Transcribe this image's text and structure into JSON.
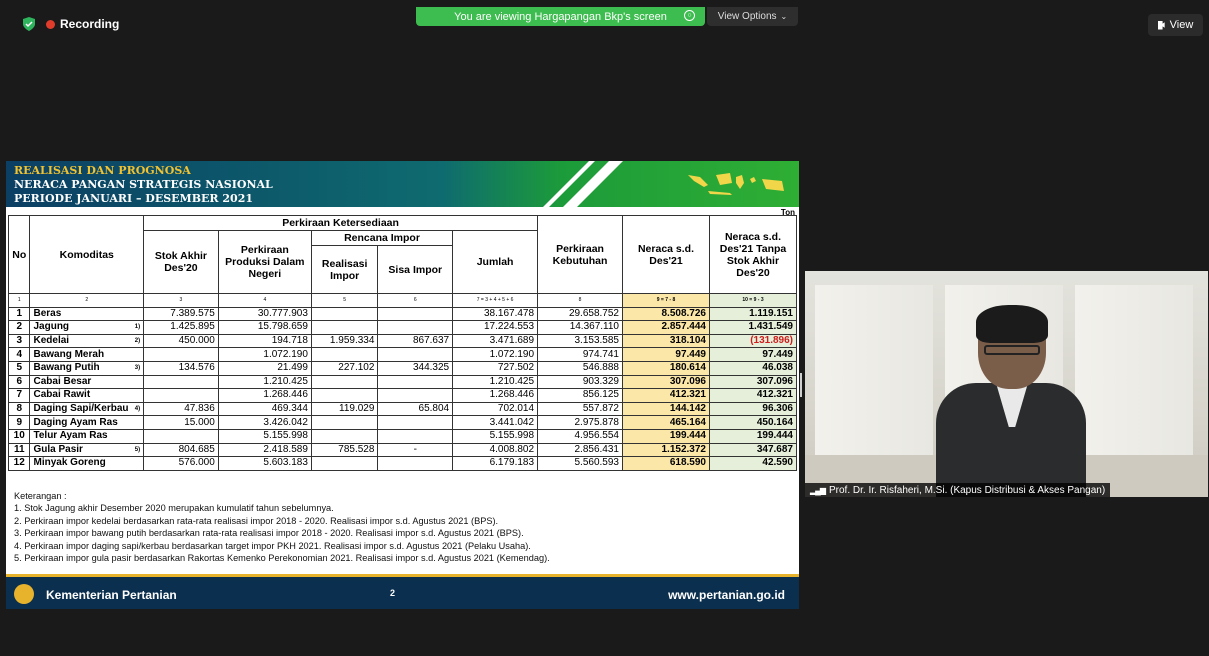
{
  "topbar": {
    "recording_label": "Recording",
    "share_banner": "You are viewing Hargapangan Bkp's screen",
    "view_options": "View Options",
    "view_button": "View"
  },
  "slide": {
    "title_line1": "REALISASI DAN PROGNOSA",
    "title_line2": "NERACA PANGAN STRATEGIS NASIONAL",
    "title_line3": "PERIODE JANUARI – DESEMBER 2021",
    "unit": "Ton",
    "headers": {
      "no": "No",
      "komoditas": "Komoditas",
      "perkiraan_ketersediaan": "Perkiraan Ketersediaan",
      "rencana_impor": "Rencana Impor",
      "stok_akhir": "Stok Akhir Des'20",
      "produksi": "Perkiraan Produksi Dalam Negeri",
      "realisasi_impor": "Realisasi Impor",
      "sisa_impor": "Sisa Impor",
      "jumlah": "Jumlah",
      "kebutuhan": "Perkiraan Kebutuhan",
      "neraca": "Neraca s.d. Des'21",
      "neraca_tanpa_stok": "Neraca s.d. Des'21 Tanpa Stok Akhir Des'20"
    },
    "index_row": [
      "1",
      "2",
      "3",
      "4",
      "5",
      "6",
      "7 = 3 + 4 + 5 + 6",
      "8",
      "9 = 7 - 8",
      "10 = 9 - 3"
    ],
    "rows": [
      {
        "no": "1",
        "name": "Beras",
        "note": "",
        "stok": "7.389.575",
        "produksi": "30.777.903",
        "realisasi": "",
        "sisa": "",
        "jumlah": "38.167.478",
        "kebutuhan": "29.658.752",
        "neraca": "8.508.726",
        "tanpa_stok": "1.119.151"
      },
      {
        "no": "2",
        "name": "Jagung",
        "note": "1)",
        "stok": "1.425.895",
        "produksi": "15.798.659",
        "realisasi": "",
        "sisa": "",
        "jumlah": "17.224.553",
        "kebutuhan": "14.367.110",
        "neraca": "2.857.444",
        "tanpa_stok": "1.431.549"
      },
      {
        "no": "3",
        "name": "Kedelai",
        "note": "2)",
        "stok": "450.000",
        "produksi": "194.718",
        "realisasi": "1.959.334",
        "sisa": "867.637",
        "jumlah": "3.471.689",
        "kebutuhan": "3.153.585",
        "neraca": "318.104",
        "tanpa_stok": "(131.896)"
      },
      {
        "no": "4",
        "name": "Bawang Merah",
        "note": "",
        "stok": "",
        "produksi": "1.072.190",
        "realisasi": "",
        "sisa": "",
        "jumlah": "1.072.190",
        "kebutuhan": "974.741",
        "neraca": "97.449",
        "tanpa_stok": "97.449"
      },
      {
        "no": "5",
        "name": "Bawang Putih",
        "note": "3)",
        "stok": "134.576",
        "produksi": "21.499",
        "realisasi": "227.102",
        "sisa": "344.325",
        "jumlah": "727.502",
        "kebutuhan": "546.888",
        "neraca": "180.614",
        "tanpa_stok": "46.038"
      },
      {
        "no": "6",
        "name": "Cabai Besar",
        "note": "",
        "stok": "",
        "produksi": "1.210.425",
        "realisasi": "",
        "sisa": "",
        "jumlah": "1.210.425",
        "kebutuhan": "903.329",
        "neraca": "307.096",
        "tanpa_stok": "307.096"
      },
      {
        "no": "7",
        "name": "Cabai Rawit",
        "note": "",
        "stok": "",
        "produksi": "1.268.446",
        "realisasi": "",
        "sisa": "",
        "jumlah": "1.268.446",
        "kebutuhan": "856.125",
        "neraca": "412.321",
        "tanpa_stok": "412.321"
      },
      {
        "no": "8",
        "name": "Daging Sapi/Kerbau",
        "note": "4)",
        "stok": "47.836",
        "produksi": "469.344",
        "realisasi": "119.029",
        "sisa": "65.804",
        "jumlah": "702.014",
        "kebutuhan": "557.872",
        "neraca": "144.142",
        "tanpa_stok": "96.306"
      },
      {
        "no": "9",
        "name": "Daging Ayam Ras",
        "note": "",
        "stok": "15.000",
        "produksi": "3.426.042",
        "realisasi": "",
        "sisa": "",
        "jumlah": "3.441.042",
        "kebutuhan": "2.975.878",
        "neraca": "465.164",
        "tanpa_stok": "450.164"
      },
      {
        "no": "10",
        "name": "Telur Ayam Ras",
        "note": "",
        "stok": "",
        "produksi": "5.155.998",
        "realisasi": "",
        "sisa": "",
        "jumlah": "5.155.998",
        "kebutuhan": "4.956.554",
        "neraca": "199.444",
        "tanpa_stok": "199.444"
      },
      {
        "no": "11",
        "name": "Gula Pasir",
        "note": "5)",
        "stok": "804.685",
        "produksi": "2.418.589",
        "realisasi": "785.528",
        "sisa": "-",
        "jumlah": "4.008.802",
        "kebutuhan": "2.856.431",
        "neraca": "1.152.372",
        "tanpa_stok": "347.687"
      },
      {
        "no": "12",
        "name": "Minyak Goreng",
        "note": "",
        "stok": "576.000",
        "produksi": "5.603.183",
        "realisasi": "",
        "sisa": "",
        "jumlah": "6.179.183",
        "kebutuhan": "5.560.593",
        "neraca": "618.590",
        "tanpa_stok": "42.590"
      }
    ],
    "notes_title": "Keterangan :",
    "notes": [
      "1. Stok Jagung akhir Desember 2020 merupakan kumulatif tahun sebelumnya.",
      "2. Perkiraan impor kedelai berdasarkan rata-rata realisasi impor 2018 - 2020. Realisasi impor s.d. Agustus 2021 (BPS).",
      "3. Perkiraan impor bawang putih berdasarkan rata-rata realisasi impor 2018 - 2020. Realisasi impor s.d. Agustus 2021 (BPS).",
      "4. Perkiraan impor daging sapi/kerbau berdasarkan target impor PKH 2021. Realisasi impor s.d. Agustus 2021 (Pelaku Usaha).",
      "5. Perkiraan impor gula pasir berdasarkan Rakortas Kemenko Perekonomian 2021. Realisasi impor s.d. Agustus 2021 (Kemendag)."
    ],
    "footer_org": "Kementerian Pertanian",
    "page_number": "2",
    "website": "www.pertanian.go.id",
    "colors": {
      "neraca_fill": "#fbe7a8",
      "stok_fill": "#e5efd9",
      "negative": "#d01c1c",
      "footer_bg": "#0b2f4e"
    }
  },
  "webcam": {
    "participant_name": "Prof. Dr. Ir. Risfaheri, M.Si. (Kapus Distribusi & Akses Pangan)"
  }
}
